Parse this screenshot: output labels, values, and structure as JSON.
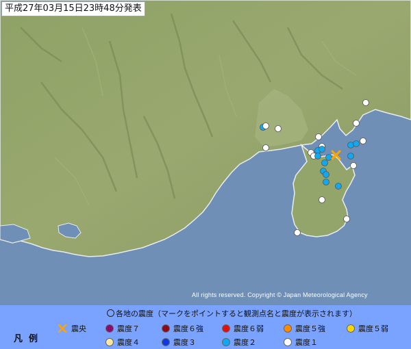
{
  "header": {
    "title": "平成27年03月15日23時48分発表"
  },
  "map": {
    "copyright": "All rights reserved. Copyright © Japan Meteorological Agency",
    "colors": {
      "sea": "#6f8fb6",
      "land": "#93a36b",
      "ridge": "#7e8f59",
      "coast": "#e8ecef"
    }
  },
  "legend": {
    "title": "各地の震度（マークをポイントすると観測点名と震度が表示されます）",
    "label": "凡例",
    "epicenter_label": "震央",
    "epicenter_color": "#ffa500",
    "items": [
      {
        "label": "震度７",
        "color": "#8a0a6f"
      },
      {
        "label": "震度６強",
        "color": "#8b0a1e"
      },
      {
        "label": "震度６弱",
        "color": "#e01010"
      },
      {
        "label": "震度５強",
        "color": "#ff8c00"
      },
      {
        "label": "震度５弱",
        "color": "#ffd700"
      },
      {
        "label": "震度４",
        "color": "#ffe8a0"
      },
      {
        "label": "震度３",
        "color": "#1038e0"
      },
      {
        "label": "震度２",
        "color": "#10a8f0"
      },
      {
        "label": "震度１",
        "color": "#ffffff"
      }
    ]
  }
}
